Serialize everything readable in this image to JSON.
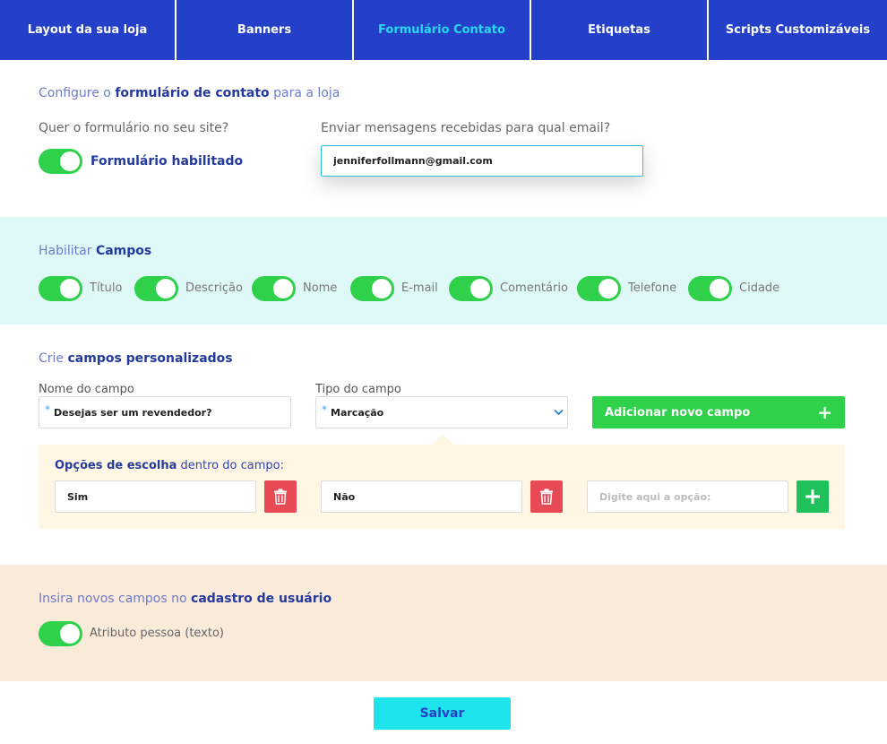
{
  "tabs": [
    {
      "label": "Layout da sua loja",
      "active": false
    },
    {
      "label": "Banners",
      "active": false
    },
    {
      "label": "Formulário Contato",
      "active": true
    },
    {
      "label": "Etiquetas",
      "active": false
    },
    {
      "label": "Scripts Customizáveis",
      "active": false
    }
  ],
  "config": {
    "title_prefix": "Configure o ",
    "title_bold": "formulário de contato",
    "title_suffix": " para a loja",
    "question": "Quer o formulário no seu site?",
    "toggle_label": "Formulário habilitado",
    "email_question": "Enviar mensagens recebidas para qual email?",
    "email_value": "jenniferfollmann@gmail.com"
  },
  "fields": {
    "title_prefix": "Habilitar ",
    "title_bold": "Campos",
    "items": [
      {
        "label": "Título",
        "enabled": true
      },
      {
        "label": "Descrição",
        "enabled": true
      },
      {
        "label": "Nome",
        "enabled": true
      },
      {
        "label": "E-mail",
        "enabled": true
      },
      {
        "label": "Comentário",
        "enabled": true
      },
      {
        "label": "Telefone",
        "enabled": true
      },
      {
        "label": "Cidade",
        "enabled": true
      }
    ]
  },
  "custom": {
    "title_prefix": "Crie ",
    "title_bold": "campos personalizados",
    "name_label": "Nome do campo",
    "name_value": "Desejas ser um revendedor?",
    "type_label": "Tipo do campo",
    "type_value": "Marcação",
    "add_button": "Adicionar novo campo",
    "options_title_bold": "Opções de escolha",
    "options_title_suffix": " dentro do campo:",
    "options": [
      "Sim",
      "Não"
    ],
    "new_option_placeholder": "Digite aqui a opção:"
  },
  "signup": {
    "title_prefix": "Insira novos campos no ",
    "title_bold": "cadastro de usuário",
    "toggle_label": "Atributo pessoa (texto)"
  },
  "save_label": "Salvar",
  "colors": {
    "primary": "#2440c8",
    "tab_active_text": "#28d8ee",
    "toggle_on": "#2fd14a",
    "cyan_band": "#dff9f8",
    "peach_band": "#f9ead9",
    "options_bg": "#fff7e3",
    "delete": "#e84a55",
    "save": "#1ce4ea"
  }
}
